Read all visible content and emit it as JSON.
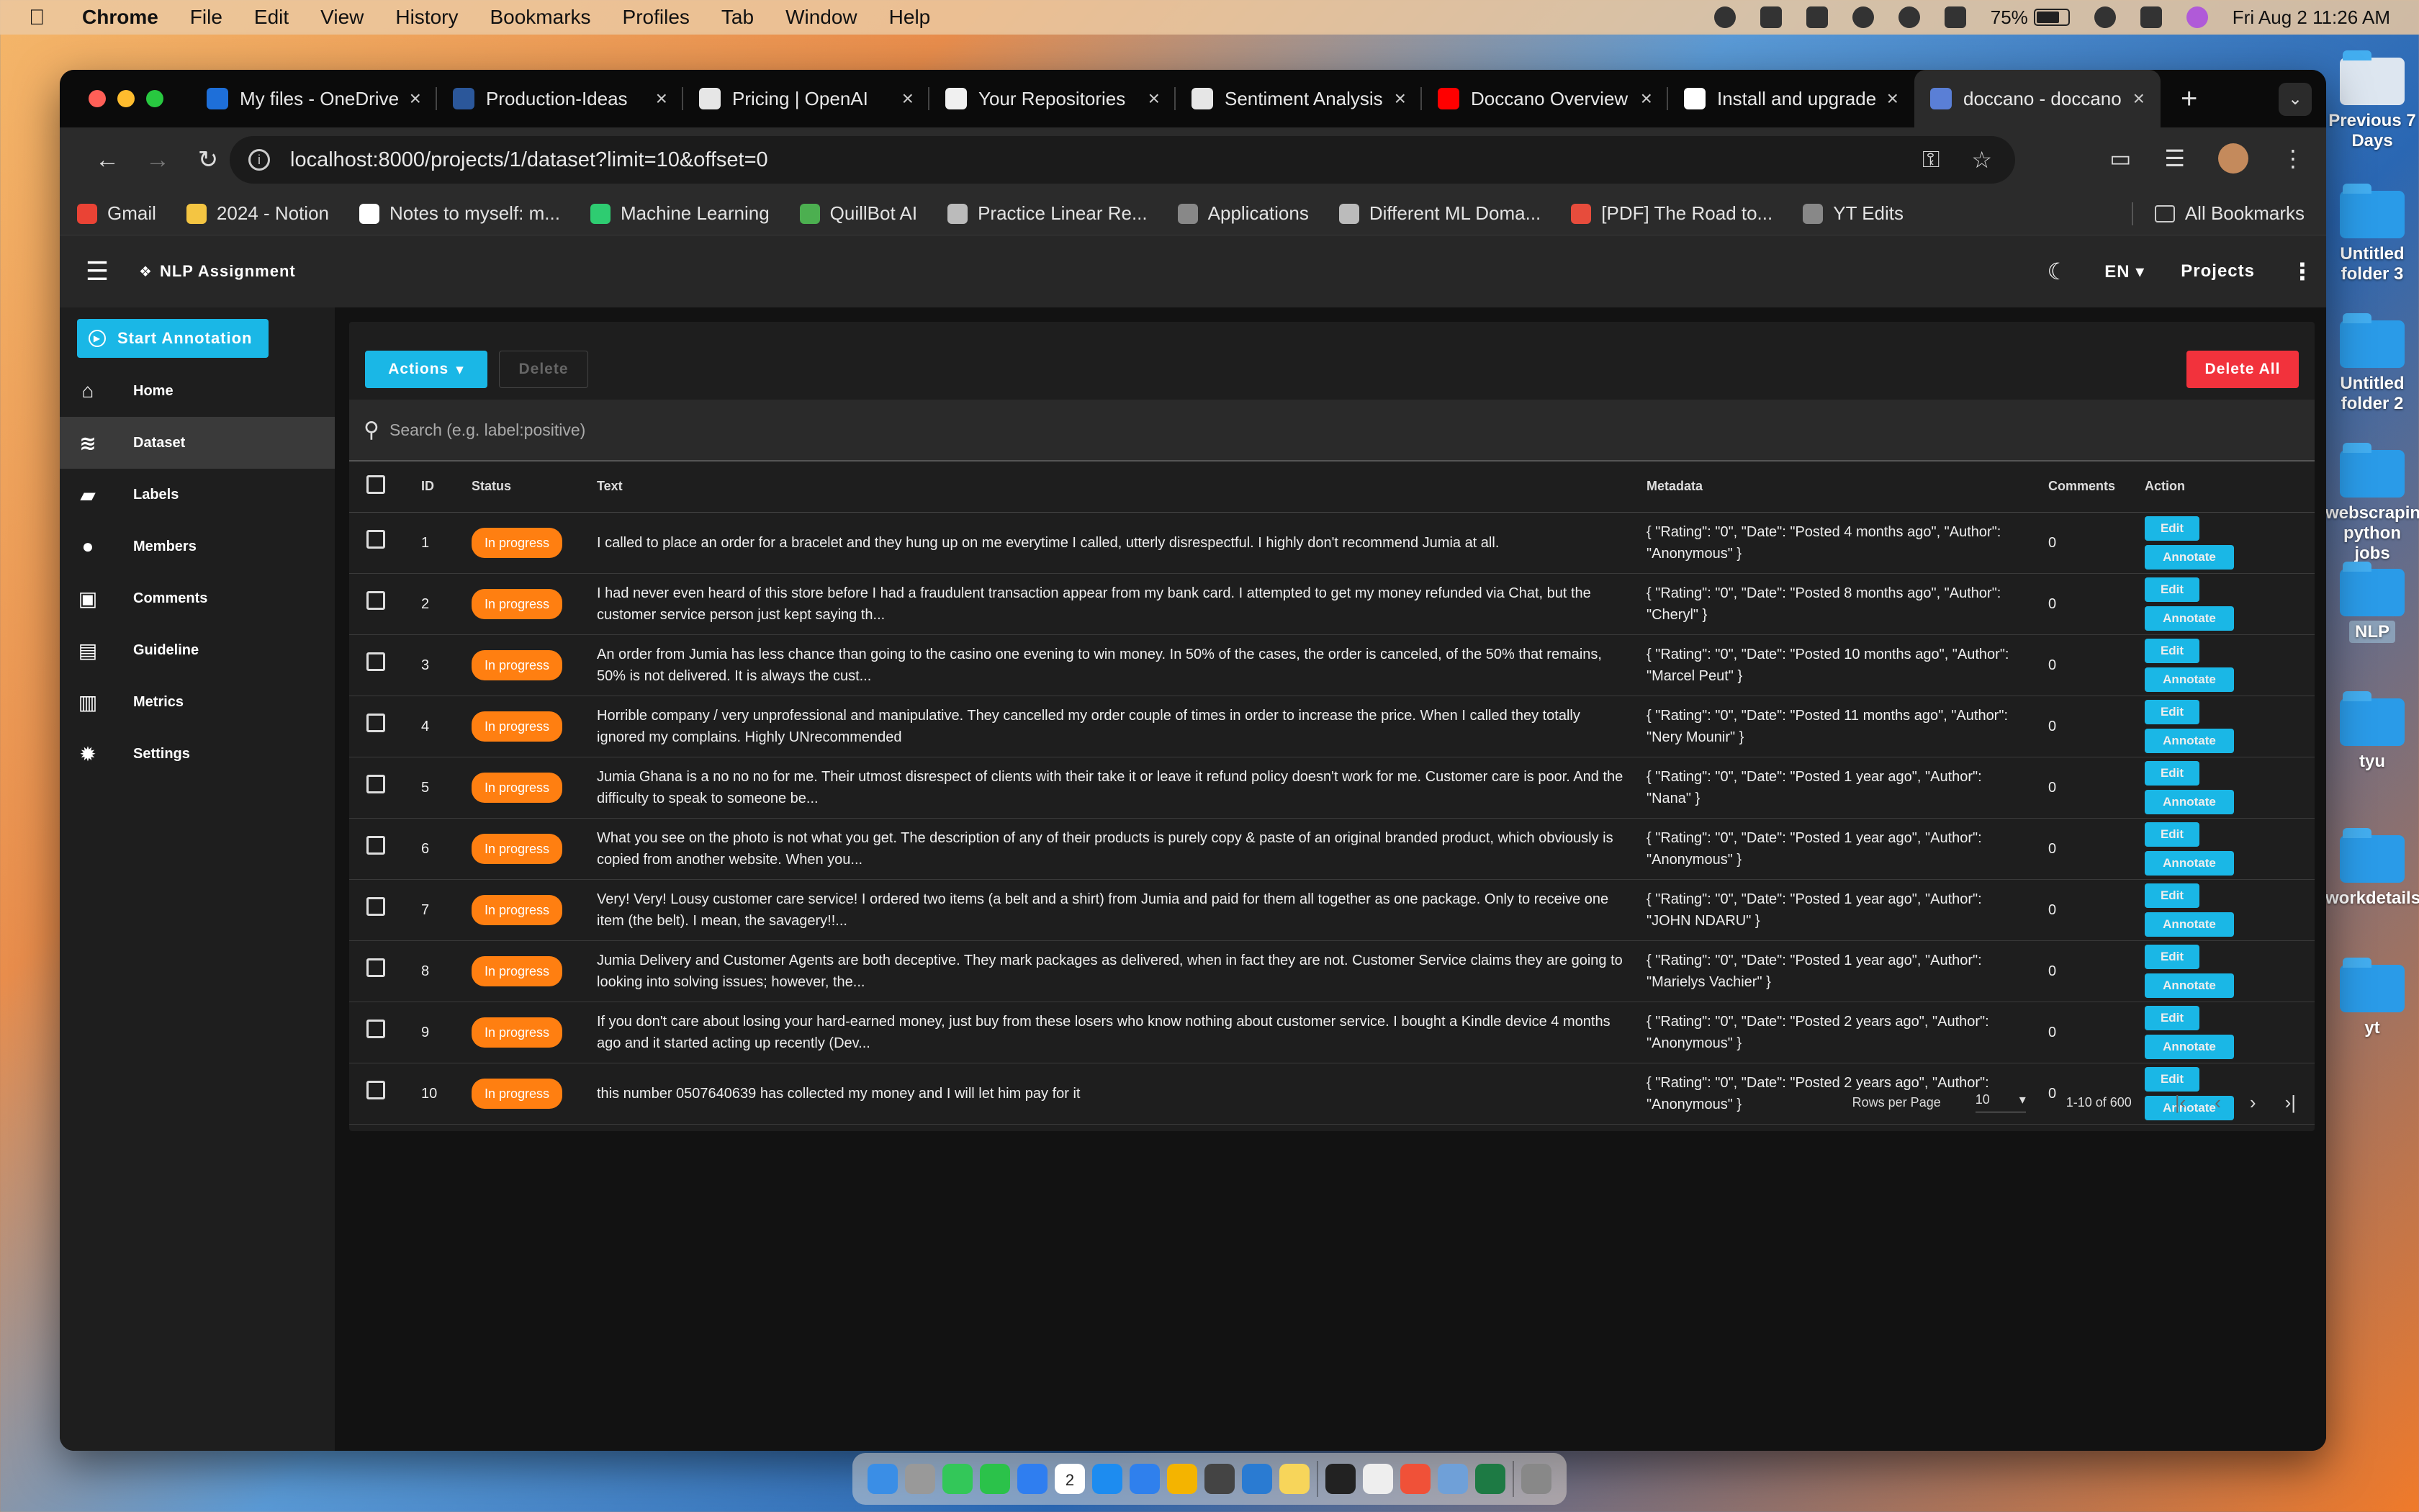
{
  "menubar": {
    "app": "Chrome",
    "items": [
      "File",
      "Edit",
      "View",
      "History",
      "Bookmarks",
      "Profiles",
      "Tab",
      "Window",
      "Help"
    ],
    "battery": "75%",
    "battery_level": 0.75,
    "clock": "Fri Aug 2  11:26 AM"
  },
  "desktop": {
    "items": [
      "Previous 7 Days",
      "Untitled folder 3",
      "Untitled folder 2",
      "webscraping python jobs",
      "NLP",
      "tyu",
      "workdetails",
      "yt"
    ]
  },
  "browser": {
    "tabs": [
      {
        "label": "My files - OneDrive",
        "color": "#1e6fd9"
      },
      {
        "label": "Production-Ideas",
        "color": "#2b579a"
      },
      {
        "label": "Pricing | OpenAI",
        "color": "#e6e6e6"
      },
      {
        "label": "Your Repositories",
        "color": "#f0f0f0"
      },
      {
        "label": "Sentiment Analysis",
        "color": "#e6e6e6"
      },
      {
        "label": "Doccano Overview",
        "color": "#ff0000"
      },
      {
        "label": "Install and upgrade",
        "color": "#ffffff"
      },
      {
        "label": "doccano - doccano",
        "color": "#5a7fd6"
      }
    ],
    "url": "localhost:8000/projects/1/dataset?limit=10&offset=0",
    "bookmarks": [
      {
        "label": "Gmail",
        "color": "#ea4335"
      },
      {
        "label": "2024 - Notion",
        "color": "#f4c542"
      },
      {
        "label": "Notes to myself: m...",
        "color": "#ffffff"
      },
      {
        "label": "Machine Learning",
        "color": "#2ecc71"
      },
      {
        "label": "QuillBot AI",
        "color": "#4caf50"
      },
      {
        "label": "Practice Linear Re...",
        "color": "#bbbbbb"
      },
      {
        "label": "Applications",
        "color": "#888888"
      },
      {
        "label": "Different ML Doma...",
        "color": "#bbbbbb"
      },
      {
        "label": "[PDF] The Road to...",
        "color": "#e74c3c"
      },
      {
        "label": "YT Edits",
        "color": "#888888"
      }
    ],
    "all_bookmarks": "All Bookmarks"
  },
  "app": {
    "title": "NLP Assignment",
    "lang": "EN",
    "projects": "Projects",
    "start_annotation": "Start Annotation",
    "nav": [
      {
        "label": "Home",
        "icon": "home-icon",
        "glyph": "⌂"
      },
      {
        "label": "Dataset",
        "icon": "database-icon",
        "glyph": "≋"
      },
      {
        "label": "Labels",
        "icon": "label-icon",
        "glyph": "▰"
      },
      {
        "label": "Members",
        "icon": "person-icon",
        "glyph": "●"
      },
      {
        "label": "Comments",
        "icon": "comment-icon",
        "glyph": "▣"
      },
      {
        "label": "Guideline",
        "icon": "book-icon",
        "glyph": "▤"
      },
      {
        "label": "Metrics",
        "icon": "chart-icon",
        "glyph": "▥"
      },
      {
        "label": "Settings",
        "icon": "gear-icon",
        "glyph": "✹"
      }
    ]
  },
  "dataset": {
    "actions": "Actions",
    "delete": "Delete",
    "delete_all": "Delete All",
    "search_placeholder": "Search (e.g. label:positive)",
    "columns": {
      "id": "ID",
      "status": "Status",
      "text": "Text",
      "metadata": "Metadata",
      "comments": "Comments",
      "action": "Action"
    },
    "edit": "Edit",
    "annotate": "Annotate",
    "rows": [
      {
        "id": "1",
        "status": "In progress",
        "text": "I called to place an order for a bracelet and they hung up on me everytime I called, utterly disrespectful. I highly don't recommend Jumia at all.",
        "metadata": "{ \"Rating\": \"0\", \"Date\": \"Posted 4 months ago\", \"Author\": \"Anonymous\" }",
        "comments": "0"
      },
      {
        "id": "2",
        "status": "In progress",
        "text": "I had never even heard of this store before I had a fraudulent transaction appear from my bank card. I attempted to get my money refunded via Chat, but the customer service person just kept saying th...",
        "metadata": "{ \"Rating\": \"0\", \"Date\": \"Posted 8 months ago\", \"Author\": \"Cheryl\" }",
        "comments": "0"
      },
      {
        "id": "3",
        "status": "In progress",
        "text": "An order from Jumia has less chance than going to the casino one evening to win money. In 50% of the cases, the order is canceled, of the 50% that remains, 50% is not delivered. It is always the cust...",
        "metadata": "{ \"Rating\": \"0\", \"Date\": \"Posted 10 months ago\", \"Author\": \"Marcel Peut\" }",
        "comments": "0"
      },
      {
        "id": "4",
        "status": "In progress",
        "text": "Horrible company / very unprofessional and manipulative. They cancelled my order couple of times in order to increase the price. When I called they totally ignored my complains. Highly UNrecommended",
        "metadata": "{ \"Rating\": \"0\", \"Date\": \"Posted 11 months ago\", \"Author\": \"Nery Mounir\" }",
        "comments": "0"
      },
      {
        "id": "5",
        "status": "In progress",
        "text": "Jumia Ghana is a no no no for me. Their utmost disrespect of clients with their take it or leave it refund policy doesn't work for me. Customer care is poor. And the difficulty to speak to someone be...",
        "metadata": "{ \"Rating\": \"0\", \"Date\": \"Posted 1 year ago\", \"Author\": \"Nana\" }",
        "comments": "0"
      },
      {
        "id": "6",
        "status": "In progress",
        "text": "What you see on the photo is not what you get. The description of any of their products is purely copy & paste of an original branded product, which obviously is copied from another website. When you...",
        "metadata": "{ \"Rating\": \"0\", \"Date\": \"Posted 1 year ago\", \"Author\": \"Anonymous\" }",
        "comments": "0"
      },
      {
        "id": "7",
        "status": "In progress",
        "text": "Very! Very! Lousy customer care service! I ordered two items (a belt and a shirt) from Jumia and paid for them all together as one package. Only to receive one item (the belt). I mean, the savagery!!...",
        "metadata": "{ \"Rating\": \"0\", \"Date\": \"Posted 1 year ago\", \"Author\": \"JOHN NDARU\" }",
        "comments": "0"
      },
      {
        "id": "8",
        "status": "In progress",
        "text": "Jumia Delivery and Customer Agents are both deceptive. They mark packages as delivered, when in fact they are not. Customer Service claims they are going to looking into solving issues; however, the...",
        "metadata": "{ \"Rating\": \"0\", \"Date\": \"Posted 1 year ago\", \"Author\": \"Marielys Vachier\" }",
        "comments": "0"
      },
      {
        "id": "9",
        "status": "In progress",
        "text": "If you don't care about losing your hard-earned money, just buy from these losers who know nothing about customer service. I bought a Kindle device 4 months ago and it started acting up recently (Dev...",
        "metadata": "{ \"Rating\": \"0\", \"Date\": \"Posted 2 years ago\", \"Author\": \"Anonymous\" }",
        "comments": "0"
      },
      {
        "id": "10",
        "status": "In progress",
        "text": "this number 0507640639 has collected my money and I will let him pay for it",
        "metadata": "{ \"Rating\": \"0\", \"Date\": \"Posted 2 years ago\", \"Author\": \"Anonymous\" }",
        "comments": "0"
      }
    ],
    "rows_per_page_label": "Rows per Page",
    "rows_per_page": "10",
    "range": "1-10 of 600"
  },
  "dock": {
    "apps": [
      "finder-icon",
      "launchpad-icon",
      "messages-icon",
      "facetime-icon",
      "mail-icon",
      "calendar-icon",
      "appstore-icon",
      "safari-icon",
      "chrome-icon",
      "chatgpt-icon",
      "vscode-icon",
      "notes-icon",
      "terminal-icon",
      "textedit-icon",
      "swift-icon",
      "preview-icon",
      "excel-icon",
      "trash-icon"
    ],
    "calendar_day": "2"
  }
}
